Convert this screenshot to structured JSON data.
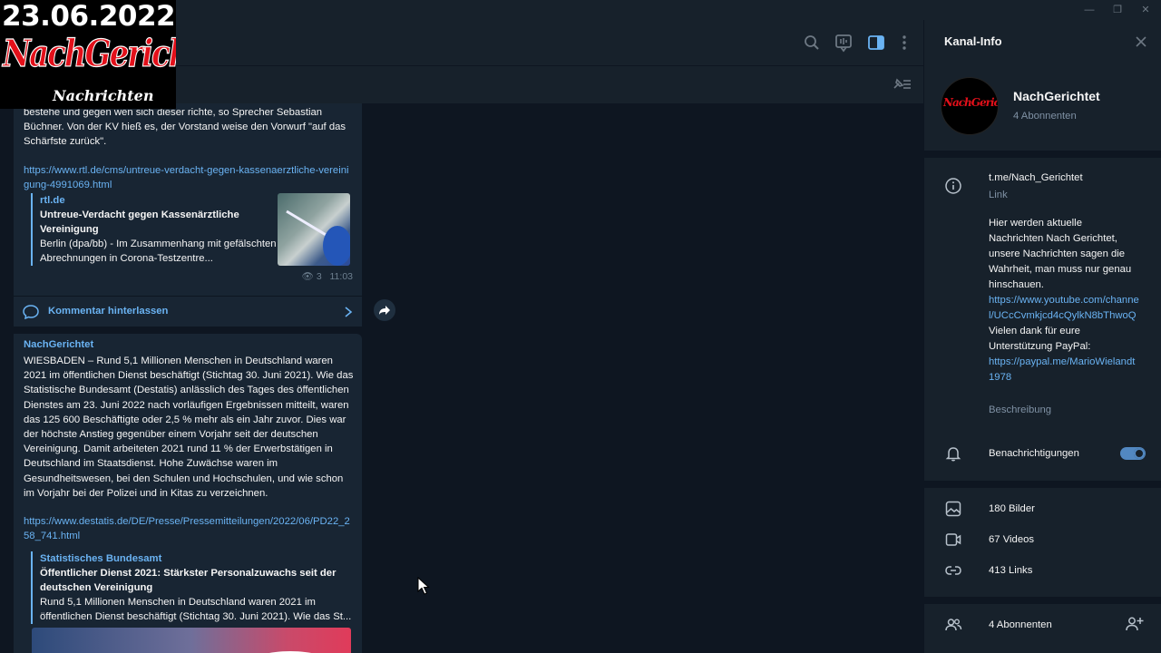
{
  "overlay": {
    "date": "23.06.2022",
    "brand": "NachGerichtet",
    "subtitle": "Nachrichten"
  },
  "messages": [
    {
      "text": "bestehe und gegen wen sich dieser richte, so Sprecher Sebastian Büchner. Von der KV hieß es, der Vorstand weise den Vorwurf \"auf das Schärfste zurück\".",
      "link": "https://www.rtl.de/cms/untreue-verdacht-gegen-kassenaerztliche-vereinigung-4991069.html",
      "preview": {
        "site": "rtl.de",
        "title": "Untreue-Verdacht gegen Kassenärztliche Vereinigung",
        "desc": "Berlin (dpa/bb) - Im Zusammenhang mit gefälschten Abrechnungen in Corona-Testzentre..."
      },
      "views": "3",
      "time": "11:03",
      "comment_label": "Kommentar hinterlassen"
    },
    {
      "sender": "NachGerichtet",
      "text": "WIESBADEN – Rund 5,1 Millionen Menschen in Deutschland waren 2021 im öffentlichen Dienst beschäftigt (Stichtag 30. Juni 2021). Wie das Statistische Bundesamt (Destatis) anlässlich des Tages des öffentlichen Dienstes am 23. Juni 2022 nach vorläufigen Ergebnissen mitteilt, waren das 125 600 Beschäftigte oder 2,5 % mehr als ein Jahr zuvor. Dies war der höchste Anstieg gegenüber einem Vorjahr seit der deutschen Vereinigung. Damit arbeiteten 2021 rund 11 % der Erwerbstätigen in Deutschland im Staatsdienst. Hohe Zuwächse waren im Gesundheitswesen, bei den Schulen und Hochschulen, und wie schon im Vorjahr bei der Polizei und in Kitas zu verzeichnen.",
      "link": "https://www.destatis.de/DE/Presse/Pressemitteilungen/2022/06/PD22_258_741.html",
      "preview": {
        "site": "Statistisches Bundesamt",
        "title": "Öffentlicher Dienst 2021: Stärkster Personalzuwachs seit der deutschen Vereinigung",
        "desc": "Rund 5,1 Millionen Menschen in Deutschland waren 2021 im öffentlichen Dienst beschäftigt (Stichtag 30. Juni 2021). Wie das St..."
      }
    }
  ],
  "panel": {
    "title": "Kanal-Info",
    "channel_name": "NachGerichtet",
    "subscribers": "4 Abonnenten",
    "link": "t.me/Nach_Gerichtet",
    "link_label": "Link",
    "description_text": "Hier werden aktuelle Nachrichten Nach Gerichtet, unsere Nachrichten sagen die Wahrheit, man muss nur genau hinschauen.",
    "youtube": "https://www.youtube.com/channel/UCcCvmkjcd4cQylkN8bThwoQ",
    "thanks": "Vielen dank für eure Unterstützung PayPal:",
    "paypal": "https://paypal.me/MarioWielandt1978",
    "description_label": "Beschreibung",
    "notifications": "Benachrichtigungen",
    "notifications_on": true,
    "media": [
      {
        "label": "180 Bilder",
        "icon": "image-icon"
      },
      {
        "label": "67 Videos",
        "icon": "video-icon"
      },
      {
        "label": "413 Links",
        "icon": "link-icon"
      }
    ],
    "members": "4 Abonnenten"
  },
  "colors": {
    "background": "#0e1621",
    "panel": "#17212b",
    "bubble": "#182533",
    "accent": "#6ab3f3"
  }
}
